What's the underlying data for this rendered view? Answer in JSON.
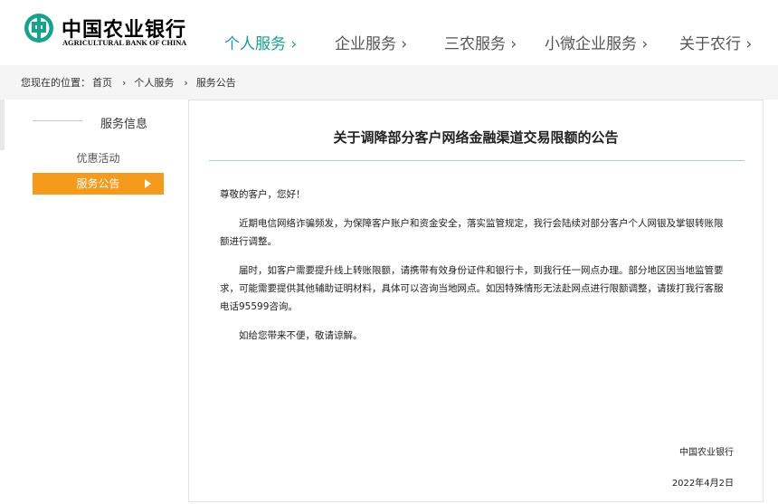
{
  "brand": {
    "name_cn": "中国农业银行",
    "name_en": "AGRICULTURAL BANK OF CHINA",
    "color": "#14a38b"
  },
  "nav": {
    "items": [
      {
        "label": "个人服务 ›",
        "active": true
      },
      {
        "label": "企业服务 ›",
        "active": false
      },
      {
        "label": "三农服务 ›",
        "active": false
      },
      {
        "label": "小微企业服务 ›",
        "active": false
      },
      {
        "label": "关于农行 ›",
        "active": false
      }
    ]
  },
  "breadcrumb": {
    "prefix": "您现在的位置：",
    "items": [
      "首页",
      "个人服务",
      "服务公告"
    ],
    "separator": "›"
  },
  "sidebar": {
    "title": "服务信息",
    "items": [
      {
        "label": "优惠活动",
        "active": false
      },
      {
        "label": "服务公告",
        "active": true
      }
    ],
    "active_color": "#f59a1a"
  },
  "article": {
    "title": "关于调降部分客户网络金融渠道交易限额的公告",
    "greeting": "尊敬的客户，您好！",
    "paragraphs": [
      "近期电信网络诈骗频发，为保障客户账户和资金安全，落实监管规定，我行会陆续对部分客户个人网银及掌银转账限额进行调整。",
      "届时，如客户需要提升线上转账限额，请携带有效身份证件和银行卡，到我行任一网点办理。部分地区因当地监管要求，可能需要提供其他辅助证明材料，具体可以咨询当地网点。如因特殊情形无法赴网点进行限额调整，请拨打我行客服电话95599咨询。",
      "如给您带来不便，敬请谅解。"
    ],
    "signature": "中国农业银行",
    "date": "2022年4月2日"
  }
}
